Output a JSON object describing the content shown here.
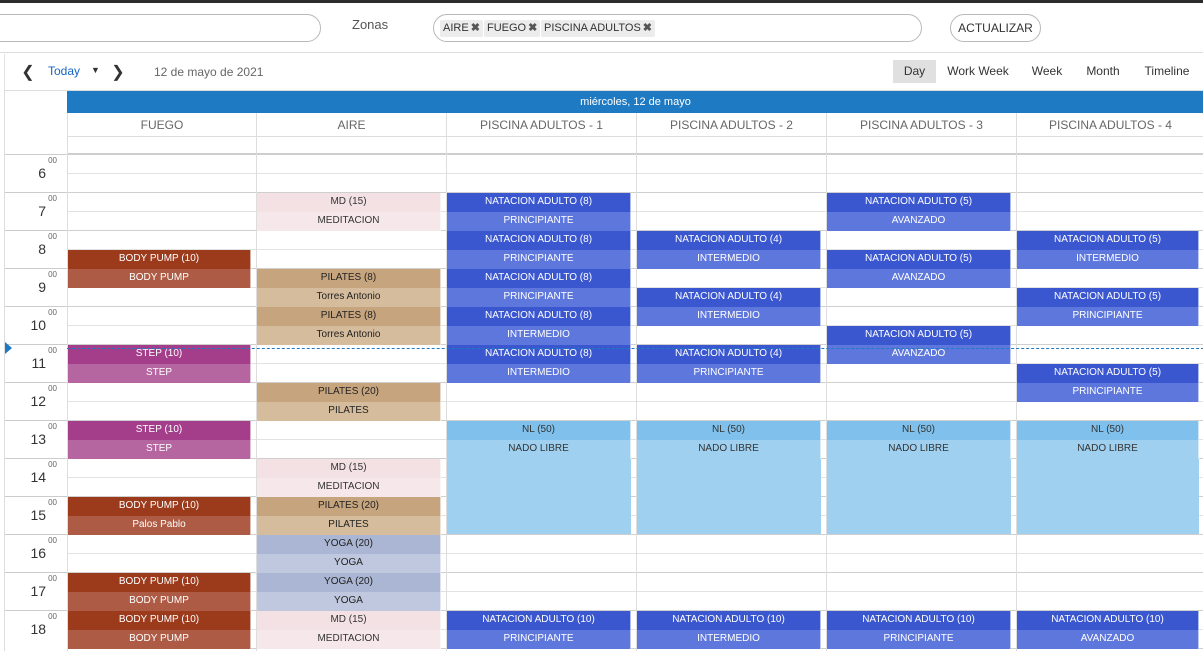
{
  "filters": {
    "zonas_label": "Zonas",
    "chips": [
      {
        "label": "AIRE"
      },
      {
        "label": "FUEGO"
      },
      {
        "label": "PISCINA ADULTOS"
      }
    ],
    "actualizar_label": "ACTUALIZAR"
  },
  "toolbar": {
    "today_label": "Today",
    "date_label": "12 de mayo de 2021",
    "views": [
      "Day",
      "Work Week",
      "Week",
      "Month",
      "Timeline"
    ],
    "active_view": "Day"
  },
  "scheduler": {
    "date_header": "miércoles, 12 de mayo",
    "resources": [
      "FUEGO",
      "AIRE",
      "PISCINA ADULTOS - 1",
      "PISCINA ADULTOS - 2",
      "PISCINA ADULTOS - 3",
      "PISCINA ADULTOS - 4"
    ],
    "hours": [
      "6",
      "7",
      "8",
      "9",
      "10",
      "11",
      "12",
      "13",
      "14",
      "15",
      "16",
      "17",
      "18"
    ],
    "minute_label": "00",
    "now_time": "11:08"
  },
  "colors": {
    "header_blue": "#1e7ac2",
    "body_pump_top": "#9c3a1c",
    "body_pump_bottom": "#ad5b45",
    "step_top": "#a53e8a",
    "step_bottom": "#b566a0",
    "md_top": "#f3e1e4",
    "md_bottom": "#f6e8ea",
    "pilates_top": "#c6a57e",
    "pilates_bottom": "#d5bc9c",
    "yoga_top": "#aab6d3",
    "yoga_bottom": "#bfc8de",
    "natacion_top": "#3a57d0",
    "natacion_bottom": "#5e77dc",
    "nl_fill": "#9fd0f0"
  },
  "events": [
    {
      "res": 0,
      "start": "8:30",
      "end": "9:30",
      "top": "BODY PUMP (10)",
      "bottom": "BODY PUMP",
      "kind": "body_pump"
    },
    {
      "res": 0,
      "start": "11:00",
      "end": "12:00",
      "top": "STEP (10)",
      "bottom": "STEP",
      "kind": "step"
    },
    {
      "res": 0,
      "start": "13:00",
      "end": "14:00",
      "top": "STEP (10)",
      "bottom": "STEP",
      "kind": "step"
    },
    {
      "res": 0,
      "start": "15:00",
      "end": "16:00",
      "top": "BODY PUMP (10)",
      "bottom": "Palos Pablo",
      "kind": "body_pump"
    },
    {
      "res": 0,
      "start": "17:00",
      "end": "18:00",
      "top": "BODY PUMP (10)",
      "bottom": "BODY PUMP",
      "kind": "body_pump"
    },
    {
      "res": 0,
      "start": "18:00",
      "end": "19:00",
      "top": "BODY PUMP (10)",
      "bottom": "BODY PUMP",
      "kind": "body_pump"
    },
    {
      "res": 1,
      "start": "7:00",
      "end": "8:00",
      "top": "MD (15)",
      "bottom": "MEDITACION",
      "kind": "md"
    },
    {
      "res": 1,
      "start": "9:00",
      "end": "10:00",
      "top": "PILATES (8)",
      "bottom": "Torres Antonio",
      "kind": "pilates"
    },
    {
      "res": 1,
      "start": "10:00",
      "end": "11:00",
      "top": "PILATES (8)",
      "bottom": "Torres Antonio",
      "kind": "pilates"
    },
    {
      "res": 1,
      "start": "12:00",
      "end": "13:00",
      "top": "PILATES (20)",
      "bottom": "PILATES",
      "kind": "pilates"
    },
    {
      "res": 1,
      "start": "14:00",
      "end": "15:00",
      "top": "MD (15)",
      "bottom": "MEDITACION",
      "kind": "md"
    },
    {
      "res": 1,
      "start": "15:00",
      "end": "16:00",
      "top": "PILATES (20)",
      "bottom": "PILATES",
      "kind": "pilates"
    },
    {
      "res": 1,
      "start": "16:00",
      "end": "17:00",
      "top": "YOGA (20)",
      "bottom": "YOGA",
      "kind": "yoga"
    },
    {
      "res": 1,
      "start": "17:00",
      "end": "18:00",
      "top": "YOGA (20)",
      "bottom": "YOGA",
      "kind": "yoga"
    },
    {
      "res": 1,
      "start": "18:00",
      "end": "19:00",
      "top": "MD (15)",
      "bottom": "MEDITACION",
      "kind": "md"
    },
    {
      "res": 2,
      "start": "7:00",
      "end": "8:00",
      "top": "NATACION ADULTO (8)",
      "bottom": "PRINCIPIANTE",
      "kind": "natacion"
    },
    {
      "res": 2,
      "start": "8:00",
      "end": "9:00",
      "top": "NATACION ADULTO (8)",
      "bottom": "PRINCIPIANTE",
      "kind": "natacion"
    },
    {
      "res": 2,
      "start": "9:00",
      "end": "10:00",
      "top": "NATACION ADULTO (8)",
      "bottom": "PRINCIPIANTE",
      "kind": "natacion"
    },
    {
      "res": 2,
      "start": "10:00",
      "end": "11:00",
      "top": "NATACION ADULTO (8)",
      "bottom": "INTERMEDIO",
      "kind": "natacion"
    },
    {
      "res": 2,
      "start": "11:00",
      "end": "12:00",
      "top": "NATACION ADULTO (8)",
      "bottom": "INTERMEDIO",
      "kind": "natacion"
    },
    {
      "res": 2,
      "start": "13:00",
      "end": "16:00",
      "top": "NL (50)",
      "bottom": "NADO LIBRE",
      "kind": "nl"
    },
    {
      "res": 2,
      "start": "18:00",
      "end": "19:00",
      "top": "NATACION ADULTO (10)",
      "bottom": "PRINCIPIANTE",
      "kind": "natacion"
    },
    {
      "res": 3,
      "start": "8:00",
      "end": "9:00",
      "top": "NATACION ADULTO (4)",
      "bottom": "INTERMEDIO",
      "kind": "natacion"
    },
    {
      "res": 3,
      "start": "9:30",
      "end": "10:30",
      "top": "NATACION ADULTO (4)",
      "bottom": "INTERMEDIO",
      "kind": "natacion"
    },
    {
      "res": 3,
      "start": "11:00",
      "end": "12:00",
      "top": "NATACION ADULTO (4)",
      "bottom": "PRINCIPIANTE",
      "kind": "natacion"
    },
    {
      "res": 3,
      "start": "13:00",
      "end": "16:00",
      "top": "NL (50)",
      "bottom": "NADO LIBRE",
      "kind": "nl"
    },
    {
      "res": 3,
      "start": "18:00",
      "end": "19:00",
      "top": "NATACION ADULTO (10)",
      "bottom": "INTERMEDIO",
      "kind": "natacion"
    },
    {
      "res": 4,
      "start": "7:00",
      "end": "8:00",
      "top": "NATACION ADULTO (5)",
      "bottom": "AVANZADO",
      "kind": "natacion"
    },
    {
      "res": 4,
      "start": "8:30",
      "end": "9:30",
      "top": "NATACION ADULTO (5)",
      "bottom": "AVANZADO",
      "kind": "natacion"
    },
    {
      "res": 4,
      "start": "10:30",
      "end": "11:30",
      "top": "NATACION ADULTO (5)",
      "bottom": "AVANZADO",
      "kind": "natacion"
    },
    {
      "res": 4,
      "start": "13:00",
      "end": "16:00",
      "top": "NL (50)",
      "bottom": "NADO LIBRE",
      "kind": "nl"
    },
    {
      "res": 4,
      "start": "18:00",
      "end": "19:00",
      "top": "NATACION ADULTO (10)",
      "bottom": "PRINCIPIANTE",
      "kind": "natacion"
    },
    {
      "res": 5,
      "start": "8:00",
      "end": "9:00",
      "top": "NATACION ADULTO (5)",
      "bottom": "INTERMEDIO",
      "kind": "natacion"
    },
    {
      "res": 5,
      "start": "9:30",
      "end": "10:30",
      "top": "NATACION ADULTO (5)",
      "bottom": "PRINCIPIANTE",
      "kind": "natacion"
    },
    {
      "res": 5,
      "start": "11:30",
      "end": "12:30",
      "top": "NATACION ADULTO (5)",
      "bottom": "PRINCIPIANTE",
      "kind": "natacion"
    },
    {
      "res": 5,
      "start": "13:00",
      "end": "16:00",
      "top": "NL (50)",
      "bottom": "NADO LIBRE",
      "kind": "nl"
    },
    {
      "res": 5,
      "start": "18:00",
      "end": "19:00",
      "top": "NATACION ADULTO (10)",
      "bottom": "AVANZADO",
      "kind": "natacion"
    }
  ]
}
